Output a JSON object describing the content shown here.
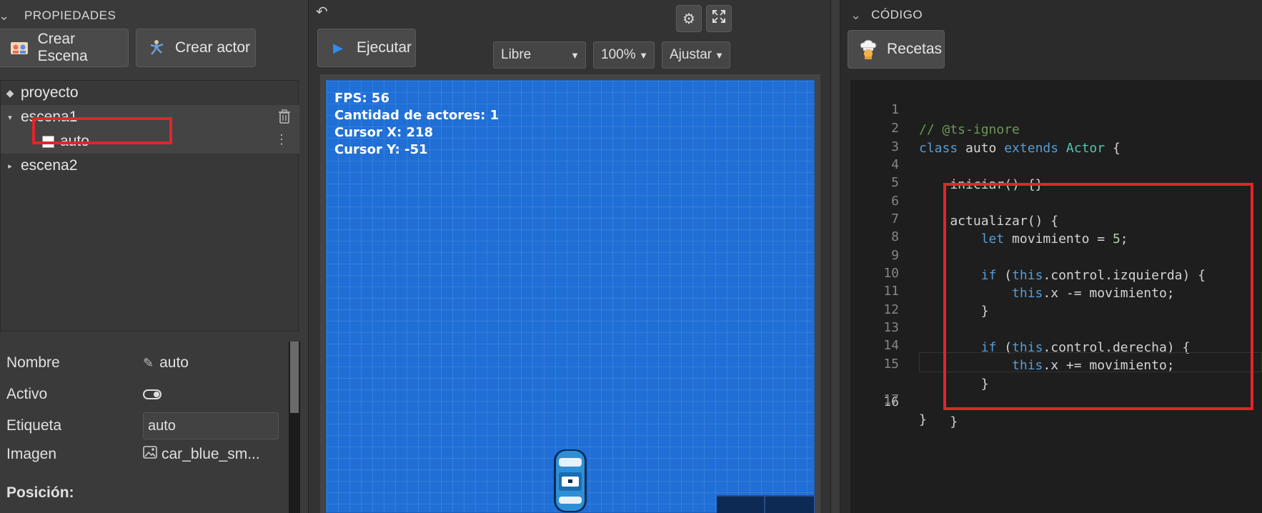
{
  "left_panel": {
    "title": "PROPIEDADES",
    "buttons": {
      "create_scene": "Crear Escena",
      "create_actor": "Crear actor"
    },
    "tree": {
      "project": "proyecto",
      "scene1": "escena1",
      "actor": "auto",
      "scene2": "escena2"
    },
    "properties": {
      "name_label": "Nombre",
      "name_value": "auto",
      "active_label": "Activo",
      "tag_label": "Etiqueta",
      "tag_value": "auto",
      "image_label": "Imagen",
      "image_value": "car_blue_sm...",
      "position_label": "Posición:"
    }
  },
  "center_panel": {
    "run_button": "Ejecutar",
    "mode_select": "Libre",
    "zoom_select": "100%",
    "fit_select": "Ajustar",
    "hud": {
      "fps": "FPS: 56",
      "actors": "Cantidad de actores: 1",
      "cursor_x": "Cursor X: 218",
      "cursor_y": "Cursor Y: -51"
    }
  },
  "right_panel": {
    "title": "CÓDIGO",
    "recipes_button": "Recetas",
    "line_numbers": [
      "1",
      "2",
      "3",
      "4",
      "5",
      "6",
      "7",
      "8",
      "9",
      "10",
      "11",
      "12",
      "13",
      "14",
      "15",
      "16",
      "17"
    ],
    "code": {
      "l1": "// @ts-ignore",
      "l2_kw": "class",
      "l2_name": " auto ",
      "l2_ext": "extends",
      "l2_base": "Actor",
      "l2_end": " {",
      "l4": "    iniciar() {}",
      "l6": "    actualizar() {",
      "l7_kw": "let",
      "l7_rest": " movimiento = ",
      "l7_num": "5",
      "l7_end": ";",
      "l9_if": "if",
      "l9_a": " (",
      "l9_this": "this",
      "l9_rest": ".control.izquierda) {",
      "l10_this": "this",
      "l10_rest": ".x -= movimiento;",
      "l11": "        }",
      "l13_if": "if",
      "l13_a": " (",
      "l13_this": "this",
      "l13_rest": ".control.derecha) {",
      "l14_this": "this",
      "l14_rest": ".x += movimiento;",
      "l15": "        }",
      "l16": "    }",
      "l17": "}"
    }
  },
  "colors": {
    "highlight": "#e0262b",
    "canvas": "#1f6fd6",
    "keyword": "#569cd6",
    "comment": "#6a9955",
    "class": "#4ec9b0"
  }
}
